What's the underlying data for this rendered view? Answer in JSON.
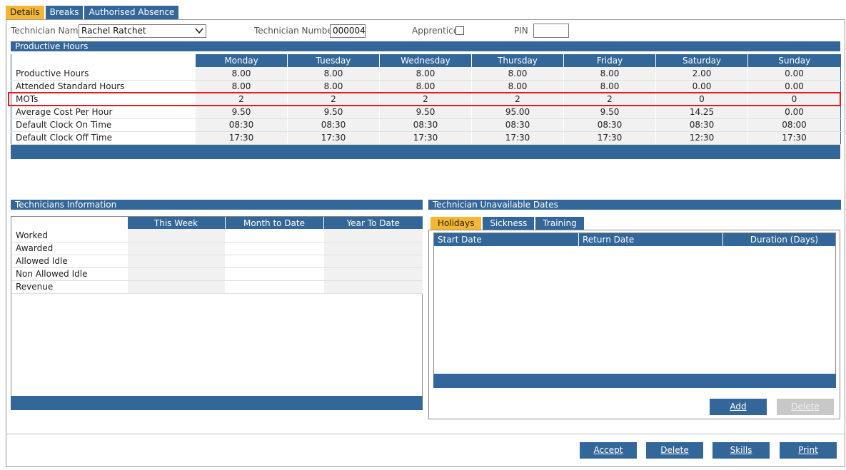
{
  "tabs": [
    "Details",
    "Breaks",
    "Authorised Absence"
  ],
  "header": {
    "technician_name_label": "Technician Name",
    "technician_name_value": "Rachel Ratchet",
    "technician_number_label": "Technician Number",
    "technician_number_value": "000004",
    "apprentice_label": "Apprentice",
    "apprentice_checked": false,
    "pin_label": "PIN",
    "pin_value": ""
  },
  "productive_hours": {
    "title": "Productive Hours",
    "days": [
      "Monday",
      "Tuesday",
      "Wednesday",
      "Thursday",
      "Friday",
      "Saturday",
      "Sunday"
    ],
    "rows": [
      {
        "label": "Productive Hours",
        "values": [
          "8.00",
          "8.00",
          "8.00",
          "8.00",
          "8.00",
          "2.00",
          "0.00"
        ]
      },
      {
        "label": "Attended Standard Hours",
        "values": [
          "8.00",
          "8.00",
          "8.00",
          "8.00",
          "8.00",
          "0.00",
          "0.00"
        ]
      },
      {
        "label": "MOTs",
        "values": [
          "2",
          "2",
          "2",
          "2",
          "2",
          "0",
          "0"
        ]
      },
      {
        "label": "Average Cost Per Hour",
        "values": [
          "9.50",
          "9.50",
          "9.50",
          "95.00",
          "9.50",
          "14.25",
          "0.00"
        ]
      },
      {
        "label": "Default Clock On Time",
        "values": [
          "08:30",
          "08:30",
          "08:30",
          "08:30",
          "08:30",
          "08:30",
          "08:00"
        ]
      },
      {
        "label": "Default Clock Off Time",
        "values": [
          "17:30",
          "17:30",
          "17:30",
          "17:30",
          "17:30",
          "12:30",
          "17:30"
        ]
      }
    ]
  },
  "technicians_info": {
    "title": "Technicians Information",
    "columns": [
      "This Week",
      "Month to Date",
      "Year To Date"
    ],
    "rows": [
      "Worked",
      "Awarded",
      "Allowed Idle",
      "Non Allowed Idle",
      "Revenue"
    ]
  },
  "unavailable": {
    "title": "Technician Unavailable Dates",
    "tabs": [
      "Holidays",
      "Sickness",
      "Training"
    ],
    "columns": [
      "Start Date",
      "Return Date",
      "Duration (Days)"
    ],
    "add_label": "Add",
    "delete_label": "Delete"
  },
  "footer_buttons": {
    "accept": "Accept",
    "delete": "Delete",
    "skills": "Skills",
    "print": "Print"
  },
  "colors": {
    "header_blue": "#336699",
    "active_tab": "#f5b731",
    "highlight": "#e51b1b"
  }
}
